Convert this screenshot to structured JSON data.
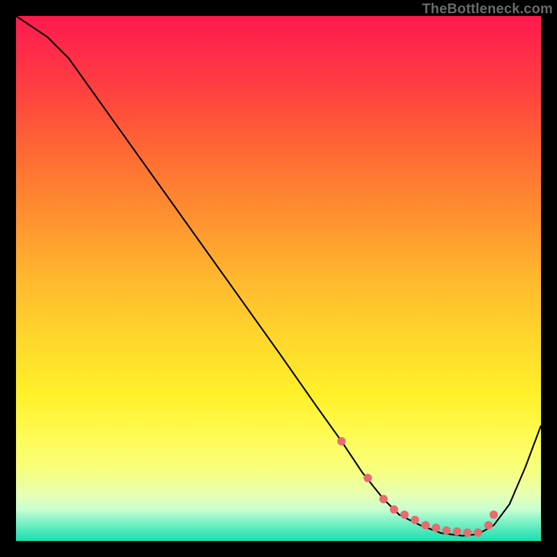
{
  "watermark": "TheBottleneck.com",
  "chart_data": {
    "type": "line",
    "title": "",
    "xlabel": "",
    "ylabel": "",
    "xlim": [
      0,
      100
    ],
    "ylim": [
      0,
      100
    ],
    "grid": false,
    "legend": false,
    "series": [
      {
        "name": "bottleneck-curve",
        "x": [
          0,
          6,
          10,
          20,
          30,
          40,
          50,
          57,
          62,
          66,
          70,
          73,
          77,
          81,
          85,
          88,
          91,
          94,
          97,
          100
        ],
        "y": [
          100,
          96,
          92,
          78,
          64,
          50,
          36,
          26,
          19,
          13,
          8,
          5,
          3,
          1.5,
          1,
          1.3,
          3,
          7,
          14,
          22
        ]
      }
    ],
    "markers": {
      "name": "optimum-dots",
      "x": [
        62,
        67,
        70,
        72,
        74,
        76,
        78,
        80,
        82,
        84,
        86,
        88,
        90,
        91
      ],
      "y": [
        19,
        12,
        8,
        6,
        5,
        4,
        3,
        2.5,
        2,
        1.8,
        1.6,
        1.6,
        3,
        5
      ],
      "color": "#e96a6f",
      "radius": 6
    }
  }
}
